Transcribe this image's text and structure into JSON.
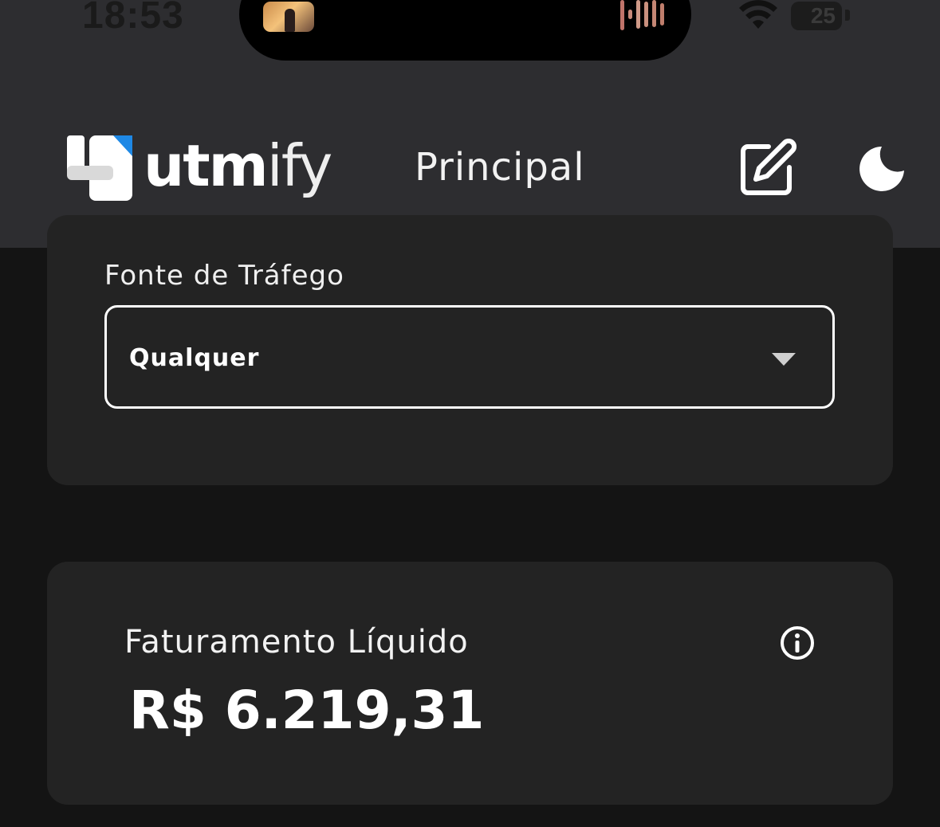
{
  "status_bar": {
    "time": "18:53",
    "battery": "25"
  },
  "header": {
    "logo_text_bold": "utm",
    "logo_text_light": "ify",
    "title": "Principal",
    "icons": {
      "edit": "edit-icon",
      "theme": "moon-icon"
    }
  },
  "filter": {
    "label": "Fonte de Tráfego",
    "selected": "Qualquer"
  },
  "metric": {
    "label": "Faturamento Líquido",
    "value": "R$ 6.219,31"
  },
  "colors": {
    "app_bar": "#2d2d30",
    "background": "#141414",
    "card": "#232323",
    "logo_accent": "#1e88e5",
    "text": "#ffffff"
  }
}
